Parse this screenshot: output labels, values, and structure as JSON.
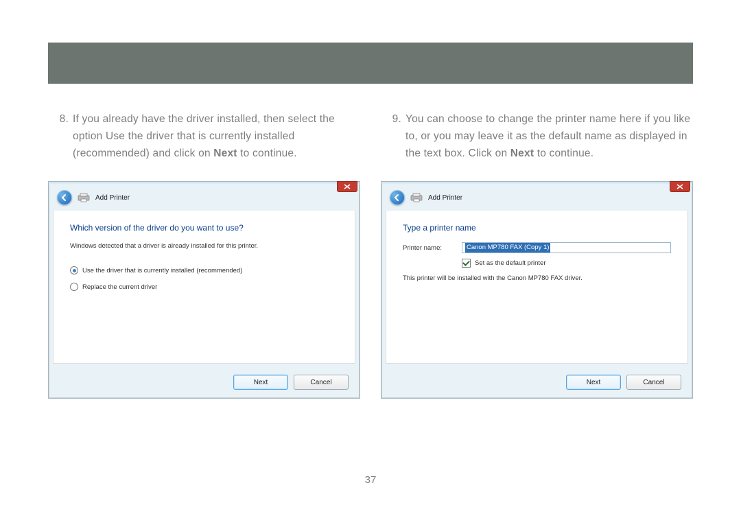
{
  "page_number": "37",
  "steps": {
    "left": {
      "num": "8.",
      "text_1": "If you already have the driver installed, then select the option Use the driver that is currently installed (recommended) and click on ",
      "bold": "Next",
      "text_2": " to continue."
    },
    "right": {
      "num": "9.",
      "text_1": "You can choose to change the printer name here if you like to, or you may leave it as the default name as displayed in the text box. Click on ",
      "bold": "Next",
      "text_2": " to continue."
    }
  },
  "dialogs": {
    "left": {
      "title": "Add Printer",
      "heading": "Which version of the driver do you want to use?",
      "desc": "Windows detected that a driver is already installed for this printer.",
      "opt1": "Use the driver that is currently installed (recommended)",
      "opt2": "Replace the current driver",
      "next": "Next",
      "cancel": "Cancel"
    },
    "right": {
      "title": "Add Printer",
      "heading": "Type a printer name",
      "label": "Printer name:",
      "value": "Canon MP780 FAX (Copy 1)",
      "chk": "Set as the default printer",
      "note": "This printer will be installed with the Canon MP780 FAX driver.",
      "next": "Next",
      "cancel": "Cancel"
    }
  },
  "icons": {
    "back": "back-arrow-icon",
    "printer": "printer-icon",
    "close": "close-icon"
  }
}
